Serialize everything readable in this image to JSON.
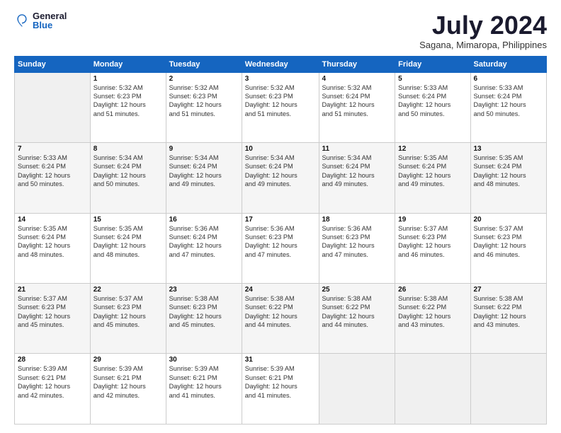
{
  "header": {
    "logo_general": "General",
    "logo_blue": "Blue",
    "title": "July 2024",
    "subtitle": "Sagana, Mimaropa, Philippines"
  },
  "days_of_week": [
    "Sunday",
    "Monday",
    "Tuesday",
    "Wednesday",
    "Thursday",
    "Friday",
    "Saturday"
  ],
  "weeks": [
    [
      {
        "day": "",
        "content": ""
      },
      {
        "day": "1",
        "content": "Sunrise: 5:32 AM\nSunset: 6:23 PM\nDaylight: 12 hours\nand 51 minutes."
      },
      {
        "day": "2",
        "content": "Sunrise: 5:32 AM\nSunset: 6:23 PM\nDaylight: 12 hours\nand 51 minutes."
      },
      {
        "day": "3",
        "content": "Sunrise: 5:32 AM\nSunset: 6:23 PM\nDaylight: 12 hours\nand 51 minutes."
      },
      {
        "day": "4",
        "content": "Sunrise: 5:32 AM\nSunset: 6:24 PM\nDaylight: 12 hours\nand 51 minutes."
      },
      {
        "day": "5",
        "content": "Sunrise: 5:33 AM\nSunset: 6:24 PM\nDaylight: 12 hours\nand 50 minutes."
      },
      {
        "day": "6",
        "content": "Sunrise: 5:33 AM\nSunset: 6:24 PM\nDaylight: 12 hours\nand 50 minutes."
      }
    ],
    [
      {
        "day": "7",
        "content": "Sunrise: 5:33 AM\nSunset: 6:24 PM\nDaylight: 12 hours\nand 50 minutes."
      },
      {
        "day": "8",
        "content": "Sunrise: 5:34 AM\nSunset: 6:24 PM\nDaylight: 12 hours\nand 50 minutes."
      },
      {
        "day": "9",
        "content": "Sunrise: 5:34 AM\nSunset: 6:24 PM\nDaylight: 12 hours\nand 49 minutes."
      },
      {
        "day": "10",
        "content": "Sunrise: 5:34 AM\nSunset: 6:24 PM\nDaylight: 12 hours\nand 49 minutes."
      },
      {
        "day": "11",
        "content": "Sunrise: 5:34 AM\nSunset: 6:24 PM\nDaylight: 12 hours\nand 49 minutes."
      },
      {
        "day": "12",
        "content": "Sunrise: 5:35 AM\nSunset: 6:24 PM\nDaylight: 12 hours\nand 49 minutes."
      },
      {
        "day": "13",
        "content": "Sunrise: 5:35 AM\nSunset: 6:24 PM\nDaylight: 12 hours\nand 48 minutes."
      }
    ],
    [
      {
        "day": "14",
        "content": "Sunrise: 5:35 AM\nSunset: 6:24 PM\nDaylight: 12 hours\nand 48 minutes."
      },
      {
        "day": "15",
        "content": "Sunrise: 5:35 AM\nSunset: 6:24 PM\nDaylight: 12 hours\nand 48 minutes."
      },
      {
        "day": "16",
        "content": "Sunrise: 5:36 AM\nSunset: 6:24 PM\nDaylight: 12 hours\nand 47 minutes."
      },
      {
        "day": "17",
        "content": "Sunrise: 5:36 AM\nSunset: 6:23 PM\nDaylight: 12 hours\nand 47 minutes."
      },
      {
        "day": "18",
        "content": "Sunrise: 5:36 AM\nSunset: 6:23 PM\nDaylight: 12 hours\nand 47 minutes."
      },
      {
        "day": "19",
        "content": "Sunrise: 5:37 AM\nSunset: 6:23 PM\nDaylight: 12 hours\nand 46 minutes."
      },
      {
        "day": "20",
        "content": "Sunrise: 5:37 AM\nSunset: 6:23 PM\nDaylight: 12 hours\nand 46 minutes."
      }
    ],
    [
      {
        "day": "21",
        "content": "Sunrise: 5:37 AM\nSunset: 6:23 PM\nDaylight: 12 hours\nand 45 minutes."
      },
      {
        "day": "22",
        "content": "Sunrise: 5:37 AM\nSunset: 6:23 PM\nDaylight: 12 hours\nand 45 minutes."
      },
      {
        "day": "23",
        "content": "Sunrise: 5:38 AM\nSunset: 6:23 PM\nDaylight: 12 hours\nand 45 minutes."
      },
      {
        "day": "24",
        "content": "Sunrise: 5:38 AM\nSunset: 6:22 PM\nDaylight: 12 hours\nand 44 minutes."
      },
      {
        "day": "25",
        "content": "Sunrise: 5:38 AM\nSunset: 6:22 PM\nDaylight: 12 hours\nand 44 minutes."
      },
      {
        "day": "26",
        "content": "Sunrise: 5:38 AM\nSunset: 6:22 PM\nDaylight: 12 hours\nand 43 minutes."
      },
      {
        "day": "27",
        "content": "Sunrise: 5:38 AM\nSunset: 6:22 PM\nDaylight: 12 hours\nand 43 minutes."
      }
    ],
    [
      {
        "day": "28",
        "content": "Sunrise: 5:39 AM\nSunset: 6:21 PM\nDaylight: 12 hours\nand 42 minutes."
      },
      {
        "day": "29",
        "content": "Sunrise: 5:39 AM\nSunset: 6:21 PM\nDaylight: 12 hours\nand 42 minutes."
      },
      {
        "day": "30",
        "content": "Sunrise: 5:39 AM\nSunset: 6:21 PM\nDaylight: 12 hours\nand 41 minutes."
      },
      {
        "day": "31",
        "content": "Sunrise: 5:39 AM\nSunset: 6:21 PM\nDaylight: 12 hours\nand 41 minutes."
      },
      {
        "day": "",
        "content": ""
      },
      {
        "day": "",
        "content": ""
      },
      {
        "day": "",
        "content": ""
      }
    ]
  ]
}
